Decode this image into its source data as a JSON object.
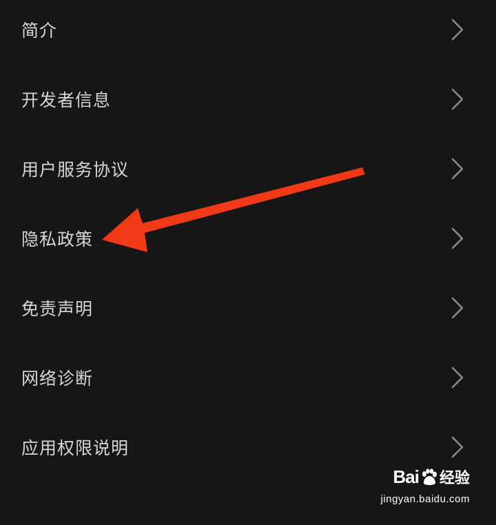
{
  "menu": {
    "items": [
      {
        "label": "简介"
      },
      {
        "label": "开发者信息"
      },
      {
        "label": "用户服务协议"
      },
      {
        "label": "隐私政策"
      },
      {
        "label": "免责声明"
      },
      {
        "label": "网络诊断"
      },
      {
        "label": "应用权限说明"
      }
    ],
    "chevron_icon": "chevron-right-icon"
  },
  "annotation": {
    "arrow_color": "#f03a17",
    "points_to": "隐私政策"
  },
  "watermark": {
    "brand_prefix": "Bai",
    "brand_suffix": "经验",
    "url": "jingyan.baidu.com"
  },
  "colors": {
    "background": "#161616",
    "text": "#d6d6d6",
    "chevron": "#8a8a8a"
  }
}
